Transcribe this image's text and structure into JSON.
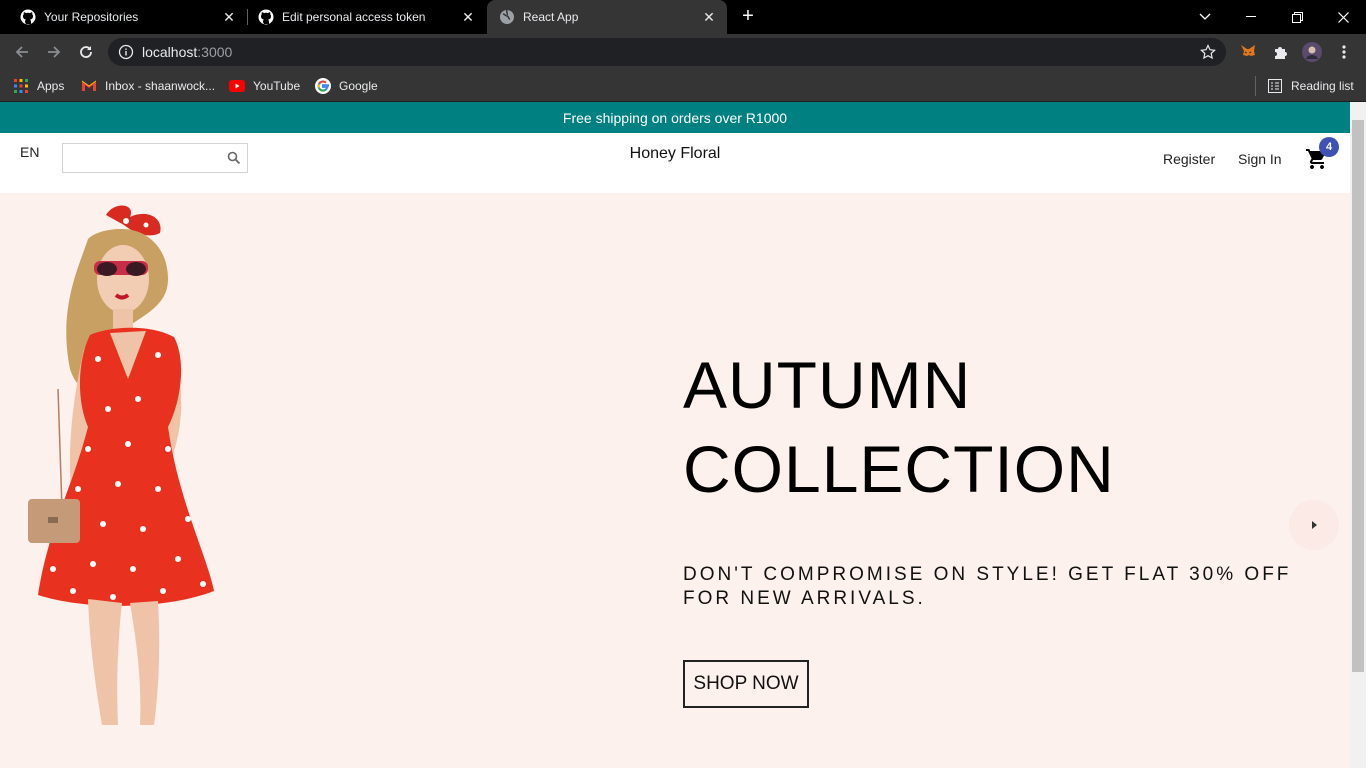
{
  "browser": {
    "tabs": [
      {
        "title": "Your Repositories",
        "icon": "github-icon"
      },
      {
        "title": "Edit personal access token",
        "icon": "github-icon"
      },
      {
        "title": "React App",
        "icon": "globe-icon"
      }
    ],
    "url_host": "localhost",
    "url_port": ":3000",
    "bookmarks": [
      {
        "label": "Apps",
        "icon": "apps-grid-icon"
      },
      {
        "label": "Inbox - shaanwock...",
        "icon": "gmail-icon"
      },
      {
        "label": "YouTube",
        "icon": "youtube-icon"
      },
      {
        "label": "Google",
        "icon": "google-icon"
      }
    ],
    "reading_list": "Reading list"
  },
  "site": {
    "announcement": "Free shipping on orders over R1000",
    "lang": "EN",
    "search_placeholder": "",
    "logo": "Honey Floral",
    "register": "Register",
    "sign_in": "Sign In",
    "cart_count": "4",
    "accent": "#008080"
  },
  "hero": {
    "title_line1": "AUTUMN",
    "title_line2": "COLLECTION",
    "description": "DON'T COMPROMISE ON STYLE! GET FLAT 30% OFF FOR NEW ARRIVALS.",
    "button": "SHOP NOW",
    "background": "#fcf1ed"
  }
}
